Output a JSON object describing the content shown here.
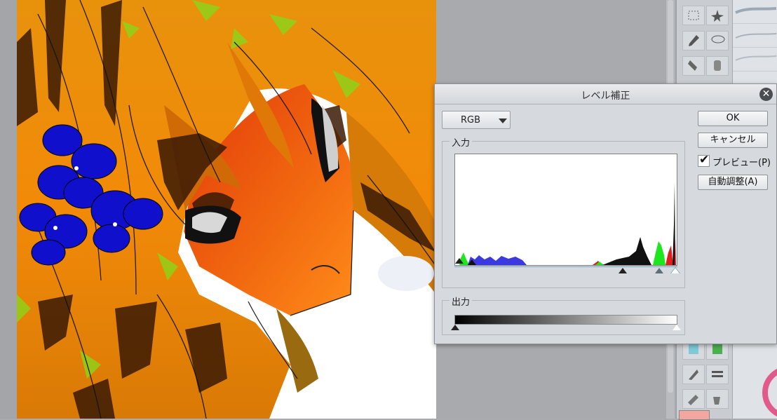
{
  "dialog": {
    "title": "レベル補正",
    "channel_select": {
      "value": "RGB",
      "options": [
        "RGB"
      ]
    },
    "input_group_label": "入力",
    "output_group_label": "出力",
    "buttons": {
      "ok": "OK",
      "cancel": "キャンセル",
      "auto": "自動調整(A)"
    },
    "preview": {
      "label": "プレビュー(P)",
      "checked": true
    }
  },
  "icons": {
    "close": "close-icon",
    "dropdown": "chevron-down-icon",
    "checkmark": "checkmark-icon"
  },
  "colors": {
    "dialog_bg": "#d6d9dd",
    "hair_orange": "#f08a0a",
    "flower_blue": "#1414d0",
    "histogram_green": "#1ee61e",
    "histogram_blue": "#3a3ae0",
    "histogram_red": "#e01e1e"
  }
}
